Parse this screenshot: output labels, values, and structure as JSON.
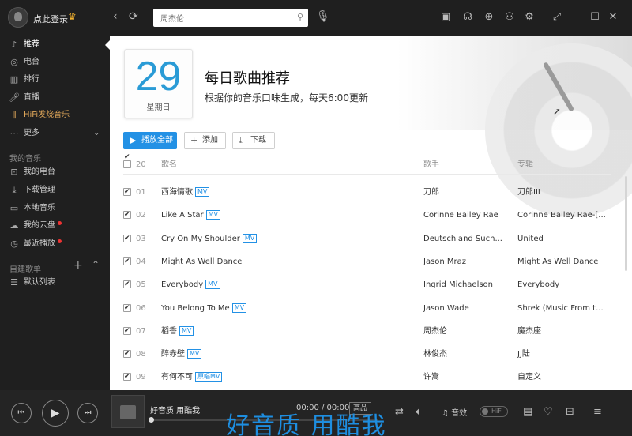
{
  "titlebar": {
    "login_text": "点此登录",
    "search_value": "周杰伦",
    "search_placeholder": "周杰伦"
  },
  "sidebar": {
    "main_items": [
      {
        "label": "推荐",
        "icon": "music-note-icon"
      },
      {
        "label": "电台",
        "icon": "radio-icon"
      },
      {
        "label": "排行",
        "icon": "chart-icon"
      },
      {
        "label": "直播",
        "icon": "microphone-icon"
      },
      {
        "label": "HiFi发烧音乐",
        "icon": "hifi-icon"
      },
      {
        "label": "更多",
        "icon": "more-icon"
      }
    ],
    "my_music_title": "我的音乐",
    "my_items": [
      {
        "label": "我的电台",
        "icon": "radio-icon"
      },
      {
        "label": "下载管理",
        "icon": "download-icon"
      },
      {
        "label": "本地音乐",
        "icon": "monitor-icon"
      },
      {
        "label": "我的云盘",
        "icon": "cloud-icon"
      },
      {
        "label": "最近播放",
        "icon": "clock-icon"
      }
    ],
    "playlist_title": "自建歌单",
    "playlist_items": [
      {
        "label": "默认列表",
        "icon": "list-icon"
      }
    ]
  },
  "banner": {
    "day": "29",
    "weekday": "星期日",
    "title": "每日歌曲推荐",
    "subtitle": "根据你的音乐口味生成，每天6:00更新"
  },
  "actions": {
    "play_all": "播放全部",
    "add": "添加",
    "download": "下载"
  },
  "table": {
    "count": "20",
    "headers": {
      "name": "歌名",
      "artist": "歌手",
      "album": "专辑"
    },
    "rows": [
      {
        "idx": "01",
        "name": "西海情歌",
        "tag": "MV",
        "artist": "刀郎",
        "album": "刀郎III"
      },
      {
        "idx": "02",
        "name": "Like A Star",
        "tag": "MV",
        "artist": "Corinne Bailey Rae",
        "album": "Corinne Bailey Rae-[..."
      },
      {
        "idx": "03",
        "name": "Cry On My Shoulder",
        "tag": "MV",
        "artist": "Deutschland Such...",
        "album": "United"
      },
      {
        "idx": "04",
        "name": "Might As Well Dance",
        "tag": "",
        "artist": "Jason Mraz",
        "album": "Might As Well Dance"
      },
      {
        "idx": "05",
        "name": "Everybody",
        "tag": "MV",
        "artist": "Ingrid Michaelson",
        "album": "Everybody"
      },
      {
        "idx": "06",
        "name": "You Belong To Me",
        "tag": "MV",
        "artist": "Jason Wade",
        "album": "Shrek (Music From t..."
      },
      {
        "idx": "07",
        "name": "稻香",
        "tag": "MV",
        "artist": "周杰伦",
        "album": "魔杰座"
      },
      {
        "idx": "08",
        "name": "醉赤壁",
        "tag": "MV",
        "artist": "林俊杰",
        "album": "JJ陆"
      },
      {
        "idx": "09",
        "name": "有何不可",
        "tag": "原唱MV",
        "artist": "许嵩",
        "album": "自定义"
      }
    ]
  },
  "player": {
    "song_title": "好音质 用酷我",
    "time": "00:00 / 00:00",
    "quality": "高品",
    "sound_effect": "音效",
    "hifi": "HiFi",
    "lyric": "好音质 用酷我",
    "progress": 0
  }
}
